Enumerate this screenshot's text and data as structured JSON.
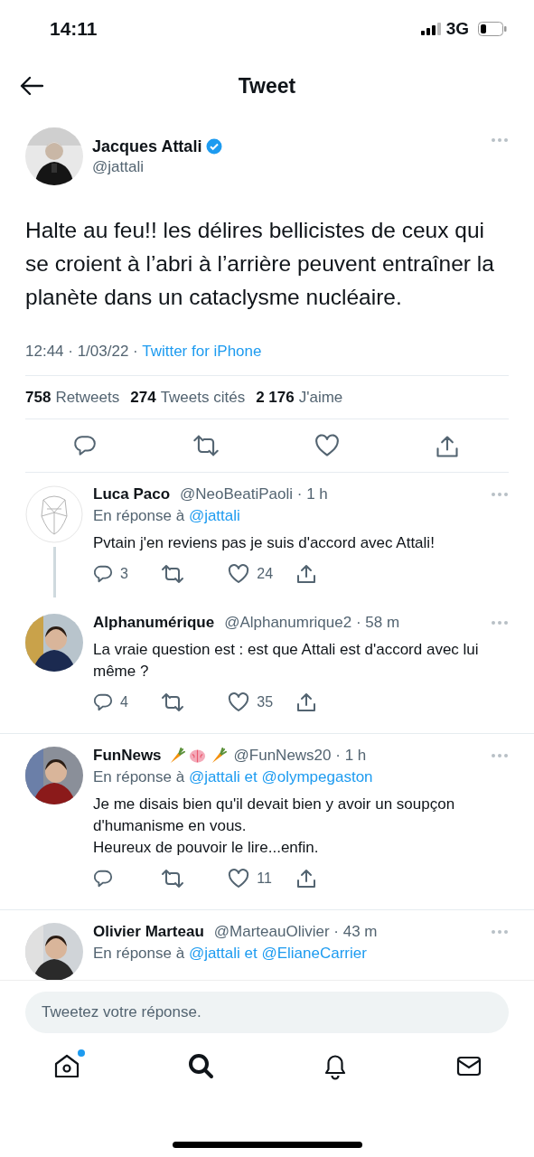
{
  "status_bar": {
    "time": "14:11",
    "network": "3G"
  },
  "header": {
    "title": "Tweet"
  },
  "tweet": {
    "name": "Jacques Attali",
    "verified": true,
    "handle": "@jattali",
    "text": "Halte au feu!! les délires bellicistes de ceux qui se croient à l’abri à l’arrière peuvent entraîner la planète dans un cataclysme nucléaire.",
    "timestamp": "12:44 · 1/03/22 ·",
    "source": "Twitter for iPhone",
    "stats": [
      {
        "count": "758",
        "label": "Retweets"
      },
      {
        "count": "274",
        "label": "Tweets cités"
      },
      {
        "count": "2 176",
        "label": "J'aime"
      }
    ]
  },
  "replies": [
    {
      "kind": "sketch",
      "name": "Luca Paco",
      "handle_time": "@NeoBeatiPaoli · 1 h",
      "reply_prefix": "En réponse à",
      "reply_to": "@jattali",
      "text": "Pvtain j'en reviens pas je suis d'accord avec Attali!",
      "reply_count": "3",
      "like_count": "24",
      "threaded": true
    },
    {
      "name": "Alphanumérique",
      "handle_time": "@Alphanumrique2 · 58 m",
      "text": "La vraie question est : est que Attali est d'accord avec lui même ?",
      "reply_count": "4",
      "like_count": "35"
    },
    {
      "kind": "photo_emoji",
      "name": "FunNews",
      "handle_time": "@FunNews20 · 1 h",
      "reply_prefix": "En réponse à",
      "reply_to": "@jattali et @olympegaston",
      "text": "Je me disais bien qu'il devait bien y avoir un soupçon d'humanisme en vous.\nHeureux de pouvoir le lire...enfin.",
      "like_count": "11"
    },
    {
      "name": "Olivier Marteau",
      "handle_time": "@MarteauOlivier · 43 m",
      "reply_prefix": "En réponse à",
      "reply_to": "@jattali et @ElianeCarrier"
    }
  ],
  "compose": {
    "placeholder": "Tweetez votre réponse."
  },
  "tab_bar": [
    {
      "kind": "home",
      "selected": false,
      "badge": true
    },
    {
      "kind": "search",
      "selected": true
    },
    {
      "kind": "bell",
      "selected": false
    },
    {
      "kind": "mail",
      "selected": false
    }
  ]
}
